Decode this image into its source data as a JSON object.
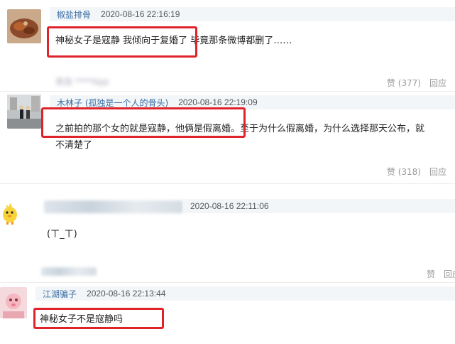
{
  "comments": [
    {
      "username": "椒盐排骨",
      "timestamp": "2020-08-16 22:16:19",
      "text": "神秘女子是寇静 我倾向于复婚了 毕竟那条微博都删了……",
      "source_blurred": "来自 ****App",
      "like_label": "赞 (377)",
      "reply_label": "回应"
    },
    {
      "username": "木林子 (孤独是一个人的骨头)",
      "timestamp": "2020-08-16 22:19:09",
      "text_line1": "之前拍的那个女的就是寇静，他俩是假离婚。至于为什么假离婚，为什么选择那天公布，就",
      "text_line2": "不清楚了",
      "like_label": "赞 (318)",
      "reply_label": "回应"
    },
    {
      "timestamp": "2020-08-16 22:11:06",
      "text": "(ㄒ_ㄒ)",
      "like_label": "赞",
      "reply_label": "回应"
    },
    {
      "username": "江湖骗子",
      "timestamp": "2020-08-16 22:13:44",
      "text": "神秘女子不是寇静吗"
    }
  ],
  "colors": {
    "highlight": "#e0232b",
    "username": "#3b6ea5",
    "meta_bg": "#f3f6f8"
  }
}
